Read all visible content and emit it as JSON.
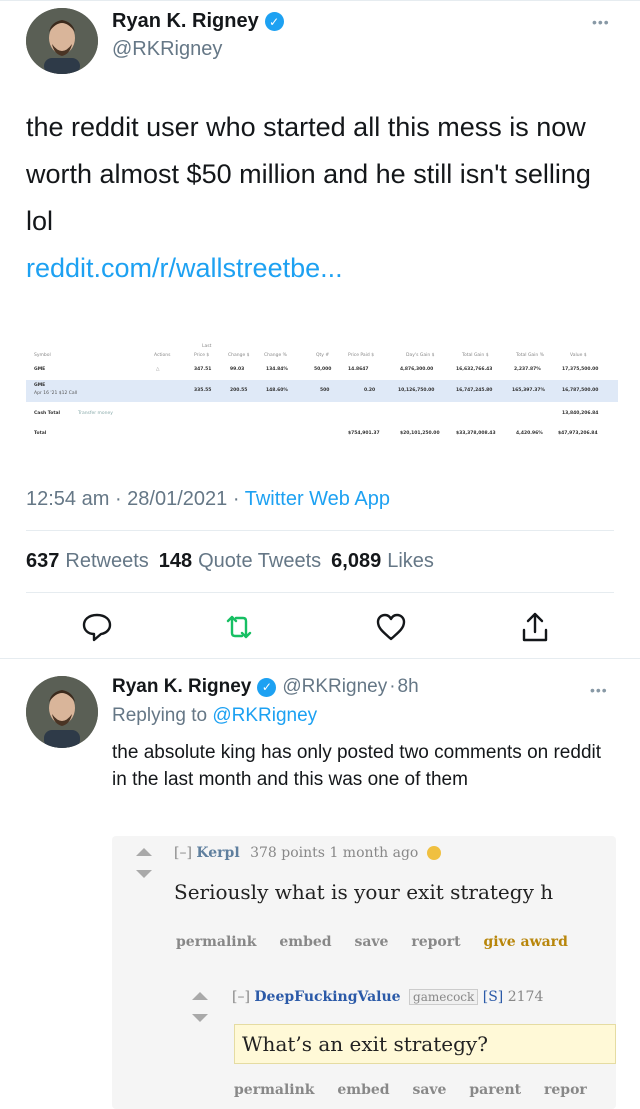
{
  "tweet": {
    "author_name": "Ryan K. Rigney",
    "author_handle": "@RKRigney",
    "text": "the reddit user who started all this mess is now worth almost $50 million and he still isn't selling lol",
    "link": "reddit.com/r/wallstreetbe...",
    "time": "12:54 am",
    "date": "28/01/2021",
    "source": "Twitter Web App",
    "retweets_count": "637",
    "retweets_label": "Retweets",
    "quotes_count": "148",
    "quotes_label": "Quote Tweets",
    "likes_count": "6,089",
    "likes_label": "Likes",
    "more_glyph": "•••",
    "verified_glyph": "✓"
  },
  "spreadsheet": {
    "header_top": "Last",
    "headers": [
      "Symbol",
      "Actions",
      "Price $",
      "Change $",
      "Change %",
      "Qty #",
      "Price Paid $",
      "Day's Gain $",
      "Total Gain $",
      "Total Gain %",
      "Value $"
    ],
    "rows": [
      {
        "symbol": "GME",
        "cells": [
          "347.51",
          "99.03",
          "134.84%",
          "50,000",
          "14.8647",
          "4,876,300.00",
          "16,632,766.43",
          "2,237.87%",
          "17,375,500.00"
        ]
      },
      {
        "symbol": "GME",
        "sub": "Apr 16 '21 $12 Call",
        "cells": [
          "335.55",
          "200.55",
          "148.60%",
          "500",
          "0.20",
          "10,126,750.00",
          "16,747,245.80",
          "165,397.37%",
          "16,787,500.00"
        ]
      },
      {
        "symbol": "Cash Total",
        "sub": "Transfer money",
        "cells": [
          "",
          "",
          "",
          "",
          "",
          "",
          "",
          "",
          "13,840,206.84"
        ]
      },
      {
        "symbol": "Total",
        "cells": [
          "",
          "",
          "",
          "",
          "$754,901.37",
          "$20,101,250.00",
          "$33,378,008.43",
          "4,420.96%",
          "$47,973,206.84"
        ]
      }
    ]
  },
  "reply": {
    "author_name": "Ryan K. Rigney",
    "author_handle": "@RKRigney",
    "separator": "·",
    "age": "8h",
    "replying_prefix": "Replying to",
    "replying_to": "@RKRigney",
    "text": "the absolute king has only posted two comments on reddit in the last month and this was one of them"
  },
  "reddit": {
    "comment1": {
      "collapse": "[–]",
      "user": "Kerpl",
      "points": "378 points",
      "age": "1 month ago",
      "body": "Seriously what is your exit strategy h",
      "links": [
        "permalink",
        "embed",
        "save",
        "report",
        "give award"
      ]
    },
    "comment2": {
      "collapse": "[–]",
      "user": "DeepFuckingValue",
      "flair": "gamecock",
      "submitter": "[S]",
      "points": "2174",
      "body": "What’s an exit strategy?",
      "links": [
        "permalink",
        "embed",
        "save",
        "parent",
        "repor"
      ]
    }
  },
  "colors": {
    "accent": "#1da1f2",
    "muted": "#657786",
    "text": "#14171a"
  },
  "icons": [
    "verified-icon",
    "reply-icon",
    "retweet-icon",
    "like-icon",
    "share-icon",
    "upvote-icon",
    "downvote-icon",
    "award-icon"
  ]
}
